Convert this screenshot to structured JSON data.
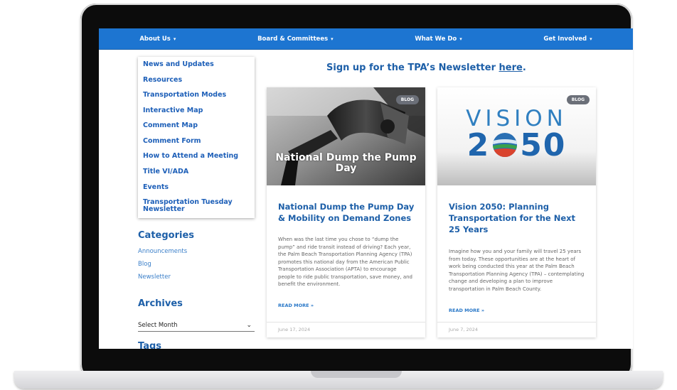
{
  "nav": {
    "items": [
      "About Us",
      "Board & Committees",
      "What We Do",
      "Get Involved"
    ],
    "caret": "▾"
  },
  "dropdown": {
    "items": [
      "News and Updates",
      "Resources",
      "Transportation Modes",
      "Interactive Map",
      "Comment Map",
      "Comment Form",
      "How to Attend a Meeting",
      "Title VI/ADA",
      "Events",
      "Transportation Tuesday Newsletter"
    ]
  },
  "sidebar": {
    "categories_title": "Categories",
    "categories": [
      "Announcements",
      "Blog",
      "Newsletter"
    ],
    "archives_title": "Archives",
    "archives_select": "Select Month",
    "tags_title": "Tags"
  },
  "signup": {
    "text": "Sign up for the TPA’s Newsletter ",
    "link": "here",
    "end": "."
  },
  "cards": [
    {
      "badge": "BLOG",
      "image_caption": "National Dump the Pump Day",
      "title": "National Dump the Pump Day & Mobility on Demand Zones",
      "excerpt": "When was the last time you chose to “dump the pump” and ride transit instead of driving? Each year, the Palm Beach Transportation Planning Agency (TPA) promotes this national day from the American Public Transportation Association (APTA) to encourage people to ride public transportation, save money, and benefit the environment.",
      "read_more": "READ MORE »",
      "date": "June 17, 2024"
    },
    {
      "badge": "BLOG",
      "image_top": "VISION",
      "image_year_left": "2",
      "image_year_right": "50",
      "title": "Vision 2050: Planning Transportation for the Next 25 Years",
      "excerpt": "Imagine how you and your family will travel 25 years from today. These opportunities are at the heart of work being conducted this year at the Palm Beach Transportation Planning Agency (TPA) – contemplating change and developing a plan to improve transportation in Palm Beach County.",
      "read_more": "READ MORE »",
      "date": "June 7, 2024"
    }
  ],
  "colors": {
    "nav_blue": "#1d75d1",
    "heading_blue": "#1d5fa8"
  }
}
